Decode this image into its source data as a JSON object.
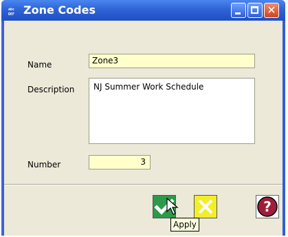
{
  "window": {
    "title": "Zone Codes"
  },
  "form": {
    "name_label": "Name",
    "name_value": "Zone3",
    "description_label": "Description",
    "description_value": "NJ Summer Work Schedule",
    "number_label": "Number",
    "number_value": "3"
  },
  "buttons": {
    "apply_tooltip": "Apply"
  },
  "colors": {
    "title_bar": "#2f63d6",
    "field_highlight": "#ffffcc",
    "ok_button": "#2c9a4a",
    "cancel_button": "#f2ee2a"
  },
  "icons": {
    "app": "abc-def-icon",
    "ok": "check-icon",
    "cancel": "x-icon",
    "help": "question-mark-icon"
  }
}
